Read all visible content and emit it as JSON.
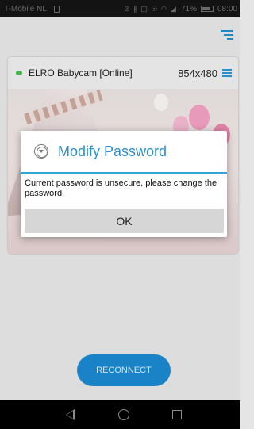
{
  "status_bar": {
    "carrier": "T-Mobile  NL",
    "icons": "⊘ ∦ ◫ ☉ ◠ ◢",
    "battery_pct": "71%",
    "time": "08:00"
  },
  "app_bar": {
    "menu_icon": "menu-icon"
  },
  "camera": {
    "name": "ELRO Babycam [Online]",
    "status": "online",
    "resolution": "854x480"
  },
  "dialog": {
    "title": "Modify Password",
    "message": "Current password is unsecure, please change the password.",
    "ok_label": "OK"
  },
  "reconnect_label": "RECONNECT",
  "colors": {
    "accent": "#2f8fcb",
    "button_blue": "#1a83c7",
    "online_green": "#3dbd4a"
  }
}
